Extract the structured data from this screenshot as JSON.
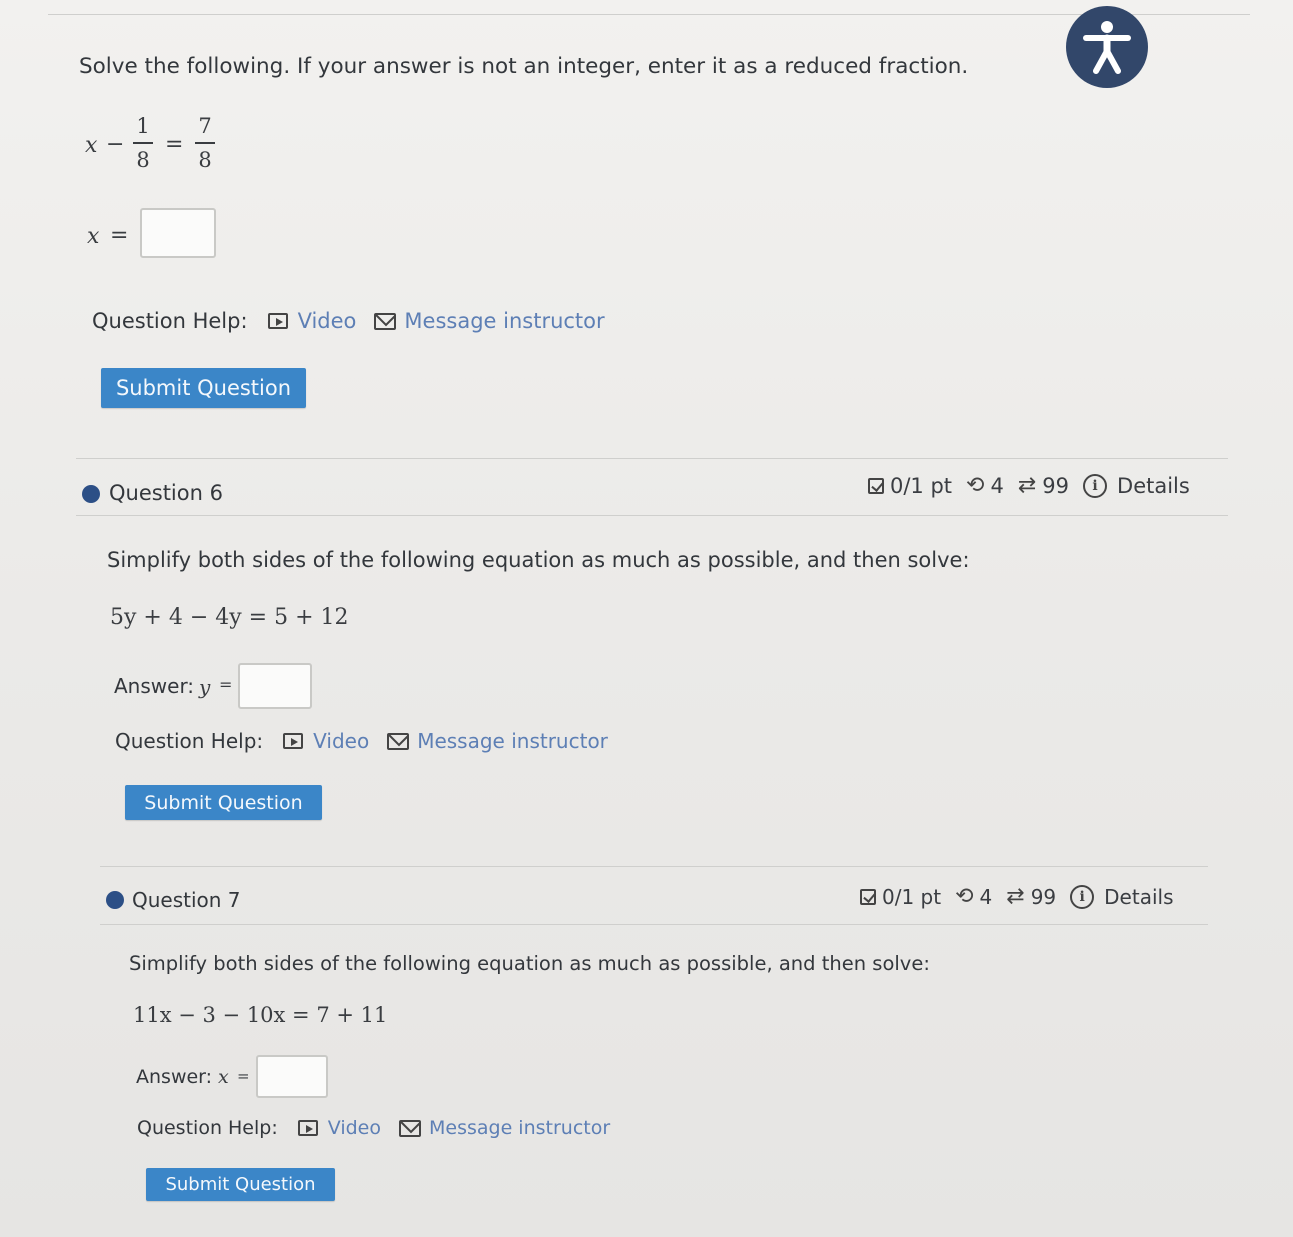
{
  "top_question": {
    "prompt": "Solve the following. If your answer is not an integer, enter it as a reduced fraction.",
    "equation": {
      "var": "x",
      "minus": "−",
      "frac1_num": "1",
      "frac1_den": "8",
      "equals": "=",
      "frac2_num": "7",
      "frac2_den": "8"
    },
    "answer_label_var": "x",
    "answer_label_eq": "=",
    "answer_value": "",
    "help_label": "Question Help:",
    "video_label": "Video",
    "message_label": "Message instructor",
    "submit_label": "Submit Question"
  },
  "questions": [
    {
      "title": "Question 6",
      "score": "0/1 pt",
      "retries": "4",
      "submissions": "99",
      "details_label": "Details",
      "prompt": "Simplify both sides of the following equation as much as possible, and then solve:",
      "equation": "5y + 4 − 4y = 5 + 12",
      "answer_label": "Answer:",
      "answer_var": "y",
      "answer_eq": "=",
      "answer_value": "",
      "help_label": "Question Help:",
      "video_label": "Video",
      "message_label": "Message instructor",
      "submit_label": "Submit Question"
    },
    {
      "title": "Question 7",
      "score": "0/1 pt",
      "retries": "4",
      "submissions": "99",
      "details_label": "Details",
      "prompt": "Simplify both sides of the following equation as much as possible, and then solve:",
      "equation": "11x − 3 − 10x = 7 + 11",
      "answer_label": "Answer:",
      "answer_var": "x",
      "answer_eq": "=",
      "answer_value": "",
      "help_label": "Question Help:",
      "video_label": "Video",
      "message_label": "Message instructor",
      "submit_label": "Submit Question"
    }
  ],
  "icons": {
    "accessibility": "accessibility-icon",
    "video": "video-icon",
    "message": "mail-icon",
    "score": "checkbox-icon",
    "retries": "retry-icon",
    "submissions": "repeat-icon",
    "details": "info-icon"
  },
  "colors": {
    "accent": "#3b86c8",
    "link": "#5d7fb5",
    "dot": "#2c4f86",
    "accessibility_bg": "#32476a"
  }
}
